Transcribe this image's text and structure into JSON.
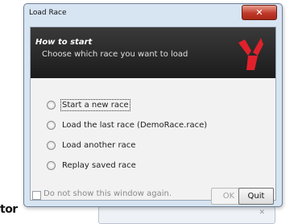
{
  "window": {
    "title": "Load Race",
    "close_glyph": "✕"
  },
  "header": {
    "title": "How to start",
    "subtitle": "Choose which race you want to load",
    "logo_icon": "brand-logo-icon",
    "logo_color": "#e0212b",
    "background": "#222222"
  },
  "options": [
    {
      "label": "Start a new race",
      "selected": false
    },
    {
      "label": "Load the last race (DemoRace.race)",
      "selected": false
    },
    {
      "label": "Load another race",
      "selected": false
    },
    {
      "label": "Replay saved race",
      "selected": false
    }
  ],
  "footer": {
    "checkbox_label": "Do not show this window again.",
    "checkbox_checked": false,
    "ok_label": "OK",
    "quit_label": "Quit"
  },
  "background_fragment": {
    "text": "tor"
  }
}
